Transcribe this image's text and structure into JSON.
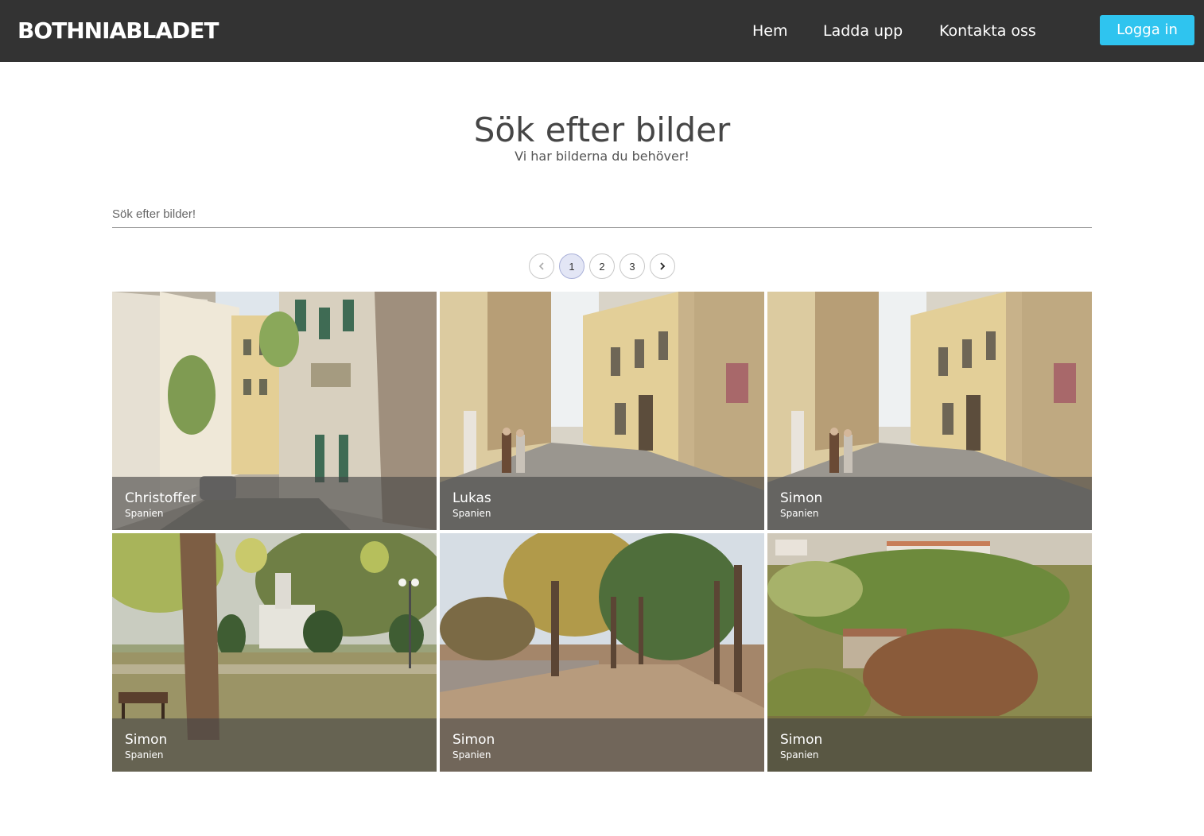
{
  "header": {
    "brand": "BOTHNIABLADET",
    "nav": {
      "home": "Hem",
      "upload": "Ladda upp",
      "contact": "Kontakta oss"
    },
    "login_label": "Logga in",
    "colors": {
      "bar": "#333333",
      "login": "#2fc4ef"
    }
  },
  "hero": {
    "title": "Sök efter bilder",
    "subtitle": "Vi har bilderna du behöver!"
  },
  "search": {
    "placeholder": "Sök efter bilder!",
    "value": ""
  },
  "pagination": {
    "prev_icon": "chevron-left-icon",
    "next_icon": "chevron-right-icon",
    "pages": [
      "1",
      "2",
      "3"
    ],
    "current": "1"
  },
  "gallery": [
    {
      "name": "Christoffer",
      "place": "Spanien",
      "scene": "narrow street"
    },
    {
      "name": "Lukas",
      "place": "Spanien",
      "scene": "street with pedestrians"
    },
    {
      "name": "Simon",
      "place": "Spanien",
      "scene": "street with pedestrians"
    },
    {
      "name": "Simon",
      "place": "Spanien",
      "scene": "park with monument"
    },
    {
      "name": "Simon",
      "place": "Spanien",
      "scene": "autumn avenue"
    },
    {
      "name": "Simon",
      "place": "Spanien",
      "scene": "hillside with trees"
    }
  ]
}
